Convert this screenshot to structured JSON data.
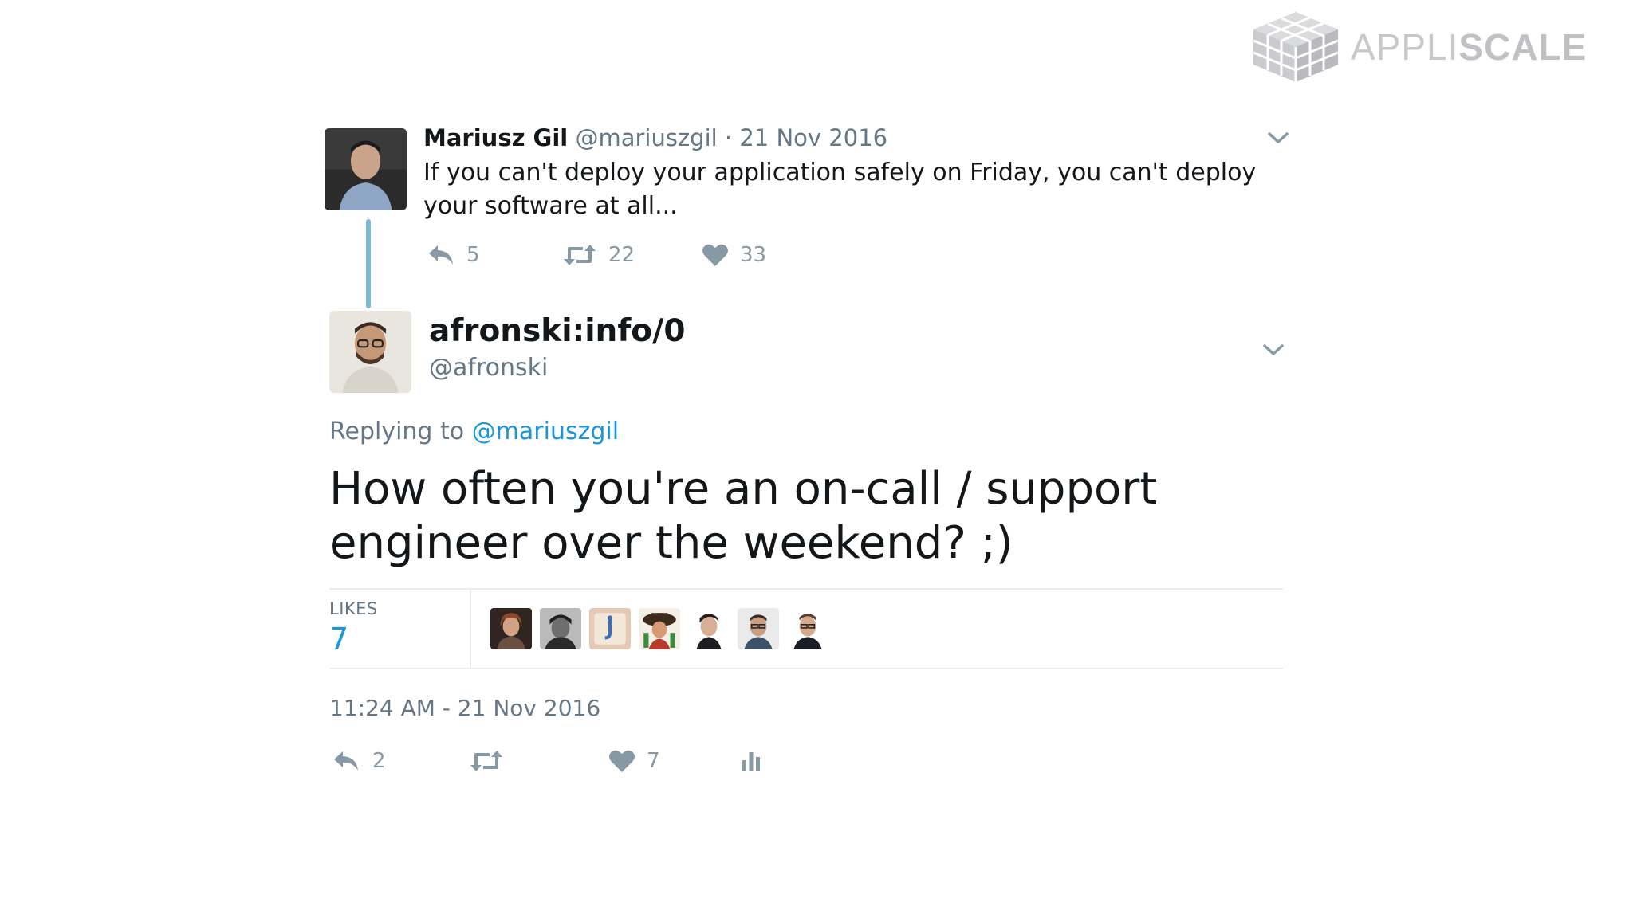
{
  "brand": {
    "name_light": "APPLI",
    "name_bold": "SCALE"
  },
  "parent_tweet": {
    "author_name": "Mariusz Gil",
    "author_handle": "@mariuszgil",
    "separator": "·",
    "date": "21 Nov 2016",
    "text": "If you can't deploy your application safely on Friday, you can't deploy your software at all...",
    "stats": {
      "replies": "5",
      "retweets": "22",
      "likes": "33"
    }
  },
  "reply_tweet": {
    "author_name": "afronski:info/0",
    "author_handle": "@afronski",
    "replying_prefix": "Replying to",
    "replying_to": "@mariuszgil",
    "text": "How often you're an on-call / support engineer over the weekend? ;)",
    "likes_label": "LIKES",
    "likes_count": "7",
    "timestamp": "11:24 AM - 21 Nov 2016",
    "stats": {
      "replies": "2",
      "likes": "7"
    }
  },
  "icons": {
    "reply": "reply-icon",
    "retweet": "retweet-icon",
    "like": "heart-icon",
    "analytics": "analytics-icon",
    "more": "chevron-down-icon"
  },
  "colors": {
    "link": "#1b95e0",
    "muted": "#657786",
    "icon": "#8899a6",
    "thread_line": "#7cbcd4",
    "brand_gray": "#c7c9cc"
  }
}
